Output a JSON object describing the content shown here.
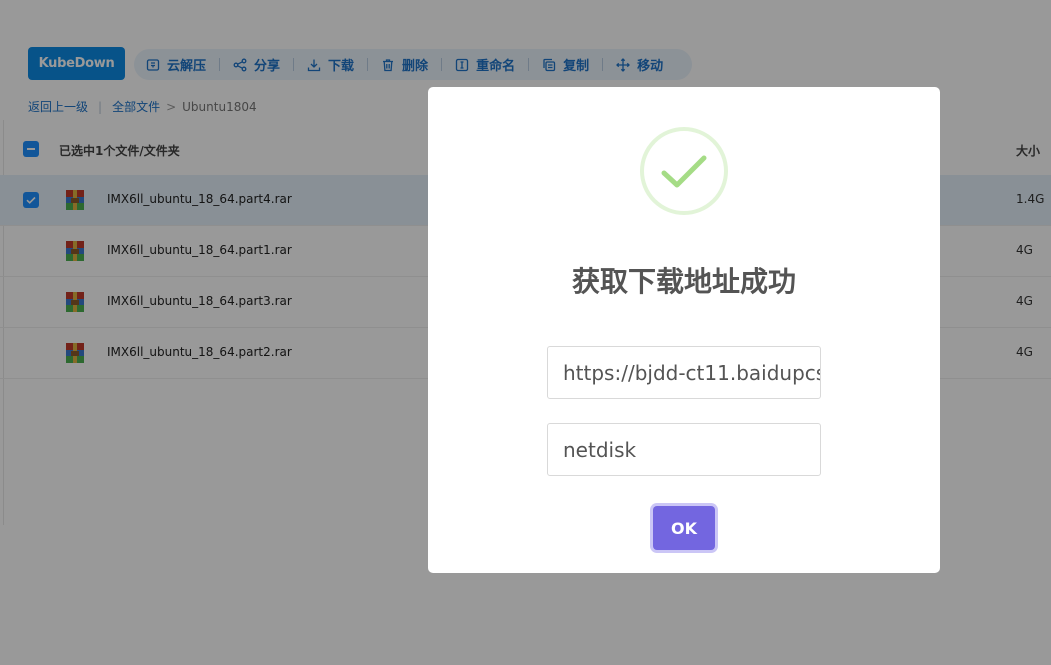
{
  "app": {
    "brand_button": "KubeDown"
  },
  "toolbar": {
    "items": [
      {
        "label": "云解压",
        "icon": "cloud-unzip-icon"
      },
      {
        "label": "分享",
        "icon": "share-icon"
      },
      {
        "label": "下载",
        "icon": "download-icon"
      },
      {
        "label": "删除",
        "icon": "trash-icon"
      },
      {
        "label": "重命名",
        "icon": "rename-icon"
      },
      {
        "label": "复制",
        "icon": "copy-icon"
      },
      {
        "label": "移动",
        "icon": "move-icon"
      }
    ]
  },
  "breadcrumb": {
    "back": "返回上一级",
    "separator": "|",
    "root": "全部文件",
    "arrow": ">",
    "current": "Ubuntu1804"
  },
  "list_header": {
    "selection_text": "已选中1个文件/文件夹",
    "size_column": "大小"
  },
  "files": [
    {
      "name": "IMX6ll_ubuntu_18_64.part4.rar",
      "size": "1.4G",
      "selected": true
    },
    {
      "name": "IMX6ll_ubuntu_18_64.part1.rar",
      "size": "4G",
      "selected": false
    },
    {
      "name": "IMX6ll_ubuntu_18_64.part3.rar",
      "size": "4G",
      "selected": false
    },
    {
      "name": "IMX6ll_ubuntu_18_64.part2.rar",
      "size": "4G",
      "selected": false
    }
  ],
  "modal": {
    "icon": "success-check-icon",
    "title": "获取下载地址成功",
    "download_url": "https://bjdd-ct11.baidupcs",
    "user_agent": "netdisk",
    "ok_label": "OK"
  },
  "colors": {
    "primary": "#0d8be5",
    "link": "#1e73c9",
    "success": "#a5dc86",
    "ok_button": "#7366e0",
    "selected_row": "#e4f0fb"
  }
}
